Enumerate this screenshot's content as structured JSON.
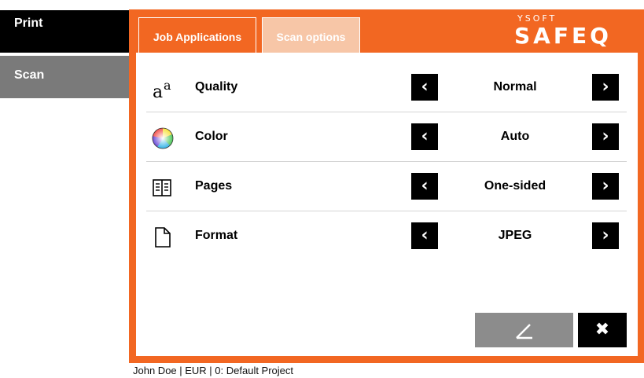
{
  "nav": {
    "print_label": "Print",
    "scan_label": "Scan"
  },
  "tabs": {
    "job_applications": "Job Applications",
    "scan_options": "Scan options"
  },
  "logo": {
    "top": "YSOFT",
    "main": "SAFEQ"
  },
  "options": [
    {
      "icon": "quality-icon",
      "label": "Quality",
      "value": "Normal"
    },
    {
      "icon": "color-wheel-icon",
      "label": "Color",
      "value": "Auto"
    },
    {
      "icon": "pages-book-icon",
      "label": "Pages",
      "value": "One-sided"
    },
    {
      "icon": "file-format-icon",
      "label": "Format",
      "value": "JPEG"
    }
  ],
  "buttons": {
    "close_glyph": "✖"
  },
  "status": {
    "text": "John Doe | EUR  | 0: Default Project"
  },
  "colors": {
    "accent": "#f26722",
    "tab_inactive": "#f7c6a7",
    "nav_active": "#000000",
    "nav_inactive": "#7a7a7a",
    "scan_button": "#8c8c8c"
  }
}
